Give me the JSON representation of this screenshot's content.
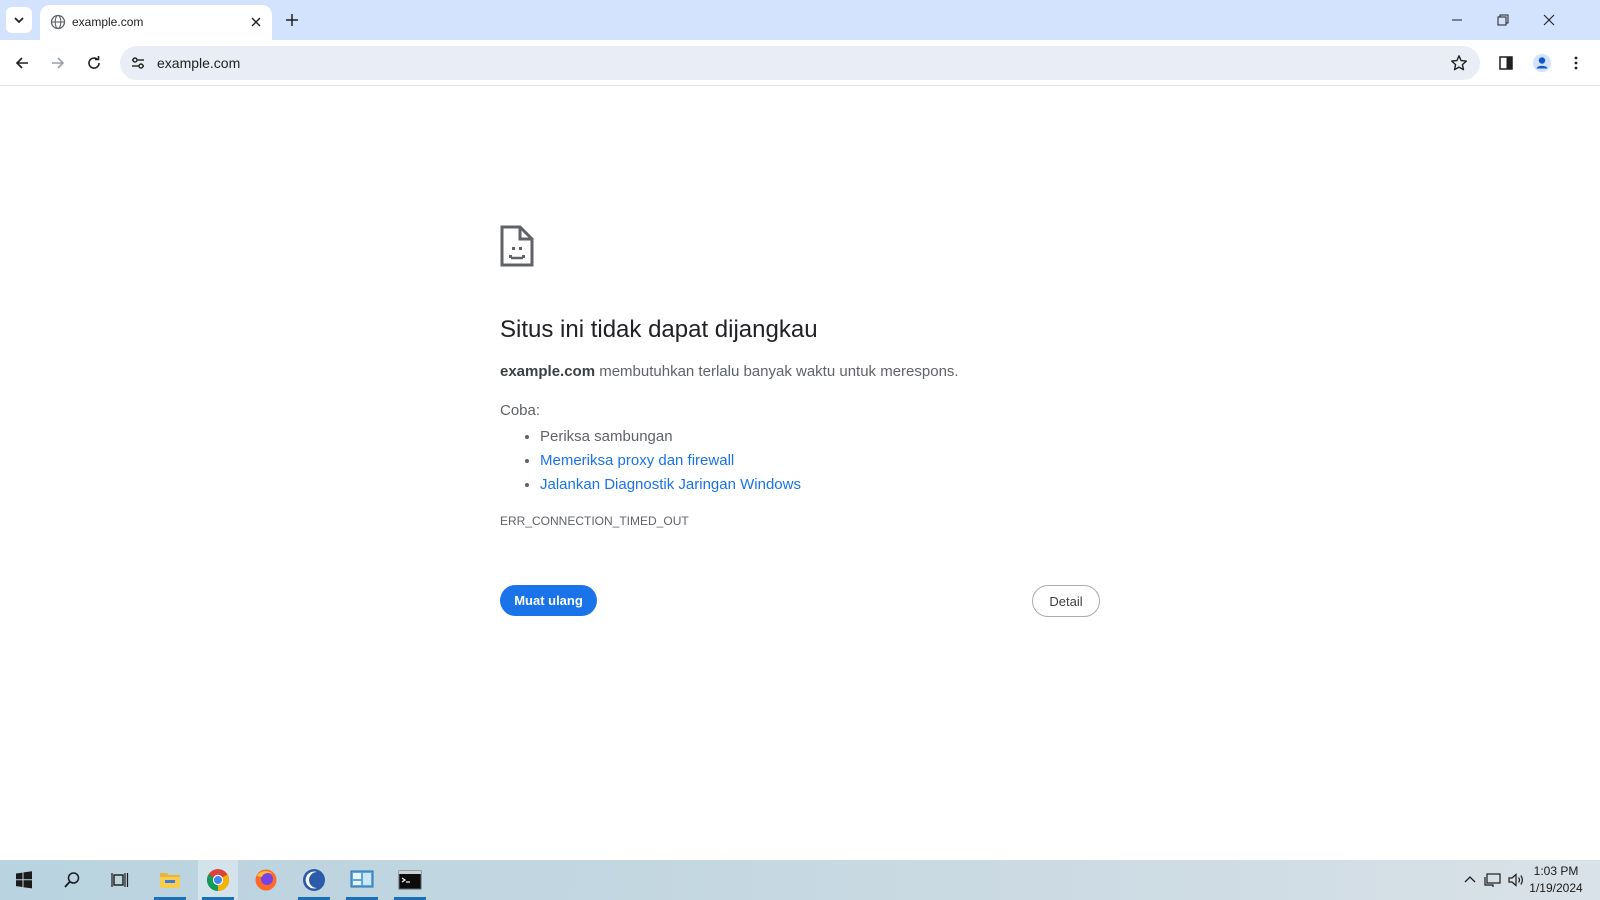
{
  "browser": {
    "tab": {
      "title": "example.com"
    },
    "omnibox": {
      "url": "example.com"
    }
  },
  "error_page": {
    "title": "Situs ini tidak dapat dijangkau",
    "description_host": "example.com",
    "description_text": " membutuhkan terlalu banyak waktu untuk merespons.",
    "try_label": "Coba:",
    "suggestions": [
      {
        "text": "Periksa sambungan",
        "is_link": false
      },
      {
        "text": "Memeriksa proxy dan firewall",
        "is_link": true
      },
      {
        "text": "Jalankan Diagnostik Jaringan Windows",
        "is_link": true
      }
    ],
    "error_code": "ERR_CONNECTION_TIMED_OUT",
    "reload_label": "Muat ulang",
    "details_label": "Detail"
  },
  "taskbar": {
    "clock_time": "1:03 PM",
    "clock_date": "1/19/2024",
    "apps": [
      "start-icon",
      "search-icon",
      "task-view-icon",
      "file-explorer-icon",
      "chrome-icon",
      "firefox-icon",
      "app-crescent-icon",
      "control-panel-icon",
      "terminal-icon"
    ]
  },
  "colors": {
    "titlebar": "#d3e3fd",
    "omnibox": "#e9eef6",
    "accent": "#1a73e8",
    "link": "#1a73e8"
  }
}
